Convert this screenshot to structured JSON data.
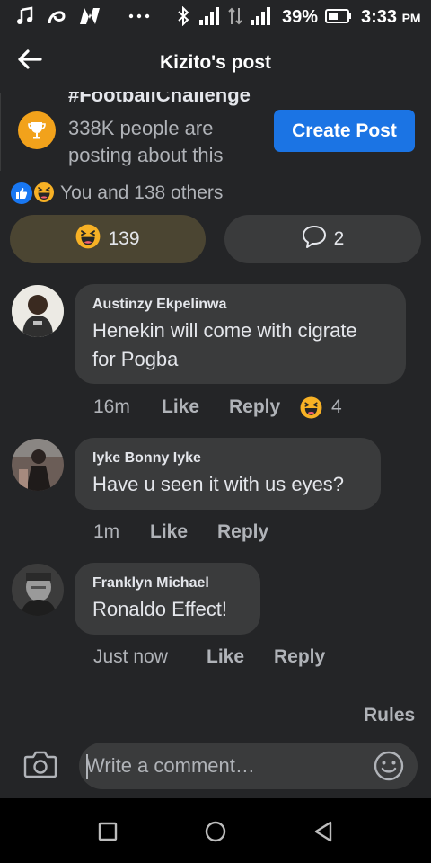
{
  "status_bar": {
    "battery_percent": "39%",
    "time": "3:33",
    "ampm": "PM"
  },
  "header": {
    "title": "Kizito's post"
  },
  "challenge": {
    "hashtag": "#FootballChallenge",
    "description": "338K people are posting about this",
    "button_label": "Create Post"
  },
  "reactions": {
    "summary": "You and 138 others",
    "haha_count": "139",
    "comment_count": "2"
  },
  "comments": [
    {
      "author": "Austinzy Ekpelinwa",
      "text_line1": "Henekin will come with cigrate",
      "text_line2": "for Pogba",
      "time": "16m",
      "like_label": "Like",
      "reply_label": "Reply",
      "reaction_count": "4"
    },
    {
      "author": "Iyke Bonny Iyke",
      "text_line1": "Have u seen it with us eyes?",
      "time": "1m",
      "like_label": "Like",
      "reply_label": "Reply"
    },
    {
      "author": "Franklyn Michael",
      "text_line1": "Ronaldo Effect!",
      "time": "Just now",
      "like_label": "Like",
      "reply_label": "Reply"
    }
  ],
  "rules_label": "Rules",
  "composer": {
    "placeholder": "Write a comment…"
  },
  "colors": {
    "background": "#242527",
    "bubble": "#3a3b3c",
    "accent": "#1b74e4",
    "haha_pill": "#4b4532",
    "trophy": "#f2a21b"
  },
  "icons": {
    "status_left": [
      "music-note-icon",
      "signal-swirl-icon",
      "n-app-icon",
      "more-dots-icon"
    ],
    "status_right": [
      "bluetooth-icon",
      "signal-bars-icon",
      "data-arrows-icon",
      "signal-bars-icon",
      "battery-icon"
    ],
    "navbar": [
      "recents-square-icon",
      "home-circle-icon",
      "back-triangle-icon"
    ]
  }
}
